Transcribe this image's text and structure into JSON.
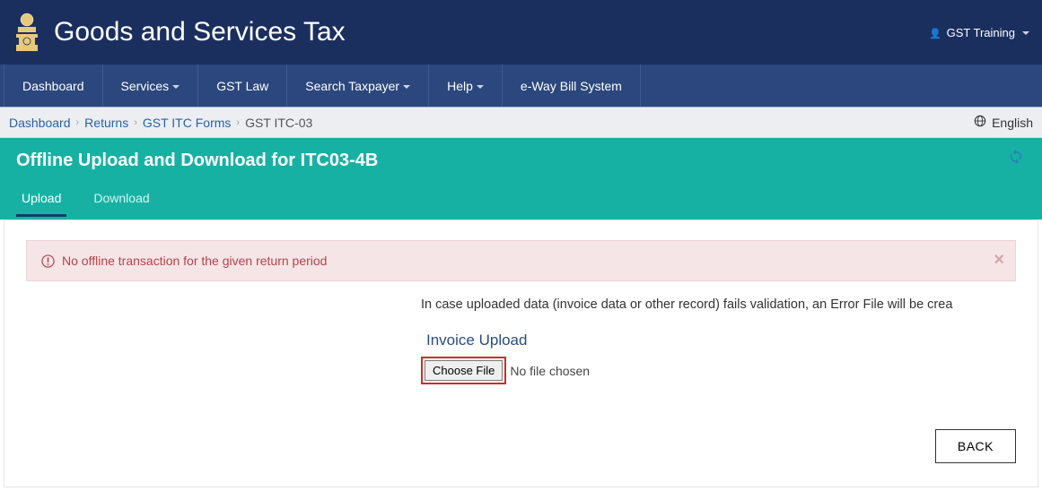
{
  "header": {
    "site_title": "Goods and Services Tax",
    "user_label": "GST Training"
  },
  "nav": {
    "items": [
      "Dashboard",
      "Services",
      "GST Law",
      "Search Taxpayer",
      "Help",
      "e-Way Bill System"
    ],
    "has_caret": [
      false,
      true,
      false,
      true,
      true,
      false
    ]
  },
  "breadcrumb": {
    "items": [
      "Dashboard",
      "Returns",
      "GST ITC Forms"
    ],
    "current": "GST ITC-03",
    "language": "English"
  },
  "panel": {
    "title": "Offline Upload and Download for ITC03-4B",
    "tabs": [
      "Upload",
      "Download"
    ],
    "active_tab": 0
  },
  "alert": {
    "message": "No offline transaction for the given return period"
  },
  "content": {
    "info_text": "In case uploaded data (invoice data or other record) fails validation, an Error File will be crea",
    "upload_heading": "Invoice Upload",
    "choose_label": "Choose File",
    "file_status": "No file chosen",
    "back_label": "BACK"
  }
}
